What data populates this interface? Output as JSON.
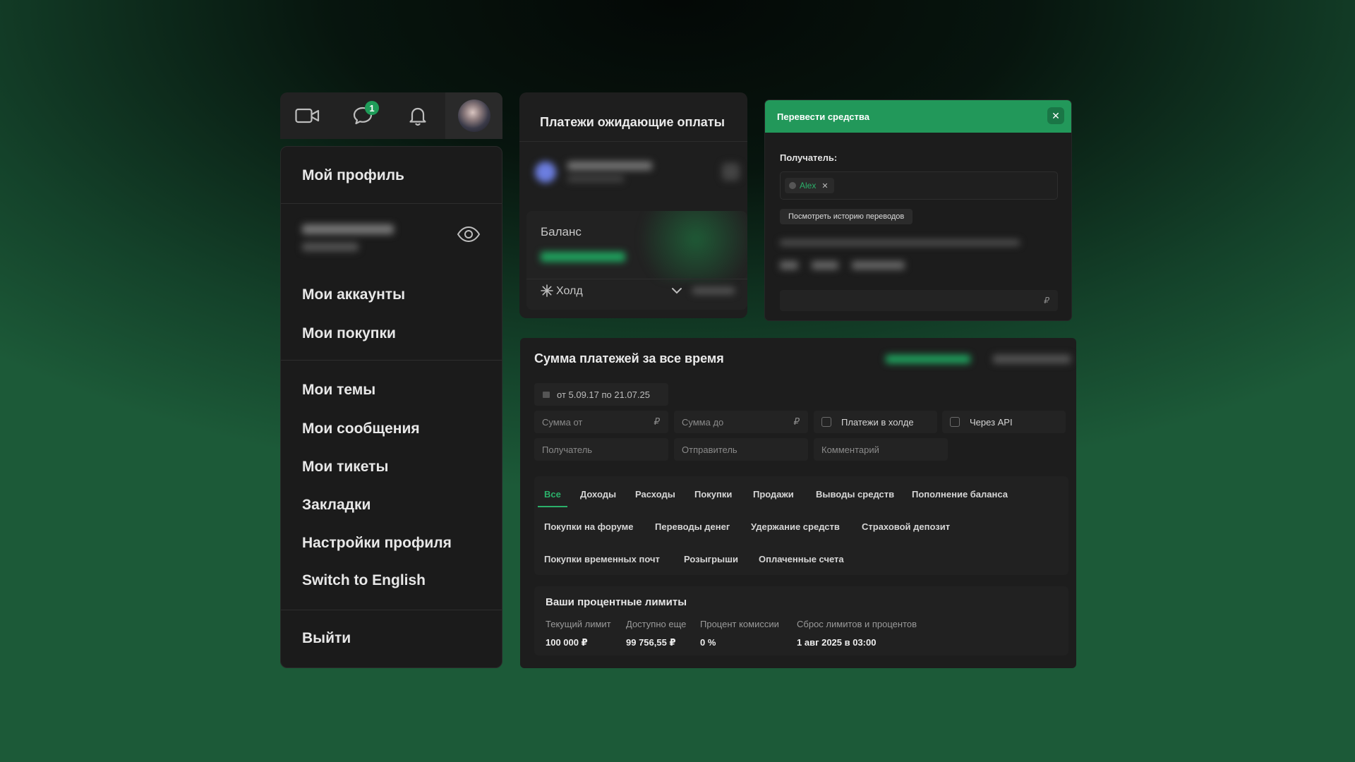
{
  "topbar": {
    "icons": [
      "video-icon",
      "chat-icon",
      "bell-icon",
      "avatar"
    ],
    "chat_badge": "1"
  },
  "menu": {
    "profile": "Мой профиль",
    "accounts": "Мои аккаунты",
    "purchases": "Мои покупки",
    "themes": "Мои темы",
    "messages": "Мои сообщения",
    "tickets": "Мои тикеты",
    "bookmarks": "Закладки",
    "settings": "Настройки профиля",
    "language": "Switch to English",
    "logout": "Выйти"
  },
  "pending": {
    "title": "Платежи ожидающие оплаты",
    "balance_label": "Баланс",
    "hold_label": "Холд"
  },
  "transfer": {
    "title": "Перевести средства",
    "recipient_label": "Получатель:",
    "recipient_tag": "Alex",
    "history_button": "Посмотреть историю переводов",
    "currency": "₽"
  },
  "stats": {
    "title": "Сумма платежей за все время",
    "date_range": "от 5.09.17 по 21.07.25",
    "sum_from_placeholder": "Сумма от",
    "sum_to_placeholder": "Сумма до",
    "currency": "₽",
    "hold_checkbox": "Платежи в холде",
    "api_checkbox": "Через API",
    "recipient_placeholder": "Получатель",
    "sender_placeholder": "Отправитель",
    "comment_placeholder": "Комментарий",
    "tabs_row1": [
      "Все",
      "Доходы",
      "Расходы",
      "Покупки",
      "Продажи",
      "Выводы средств",
      "Пополнение баланса"
    ],
    "tabs_row2": [
      "Покупки на форуме",
      "Переводы денег",
      "Удержание средств",
      "Страховой депозит"
    ],
    "tabs_row3": [
      "Покупки временных почт",
      "Розыгрыши",
      "Оплаченные счета"
    ],
    "active_tab": "Все"
  },
  "limits": {
    "title": "Ваши процентные лимиты",
    "current_label": "Текущий лимит",
    "current_value": "100 000 ₽",
    "available_label": "Доступно еще",
    "available_value": "99 756,55 ₽",
    "commission_label": "Процент комиссии",
    "commission_value": "0 %",
    "reset_label": "Сброс лимитов и процентов",
    "reset_value": "1 авг 2025 в 03:00"
  },
  "colors": {
    "accent": "#22985a",
    "panel": "#1c1c1c",
    "text": "#e6e6e6"
  }
}
